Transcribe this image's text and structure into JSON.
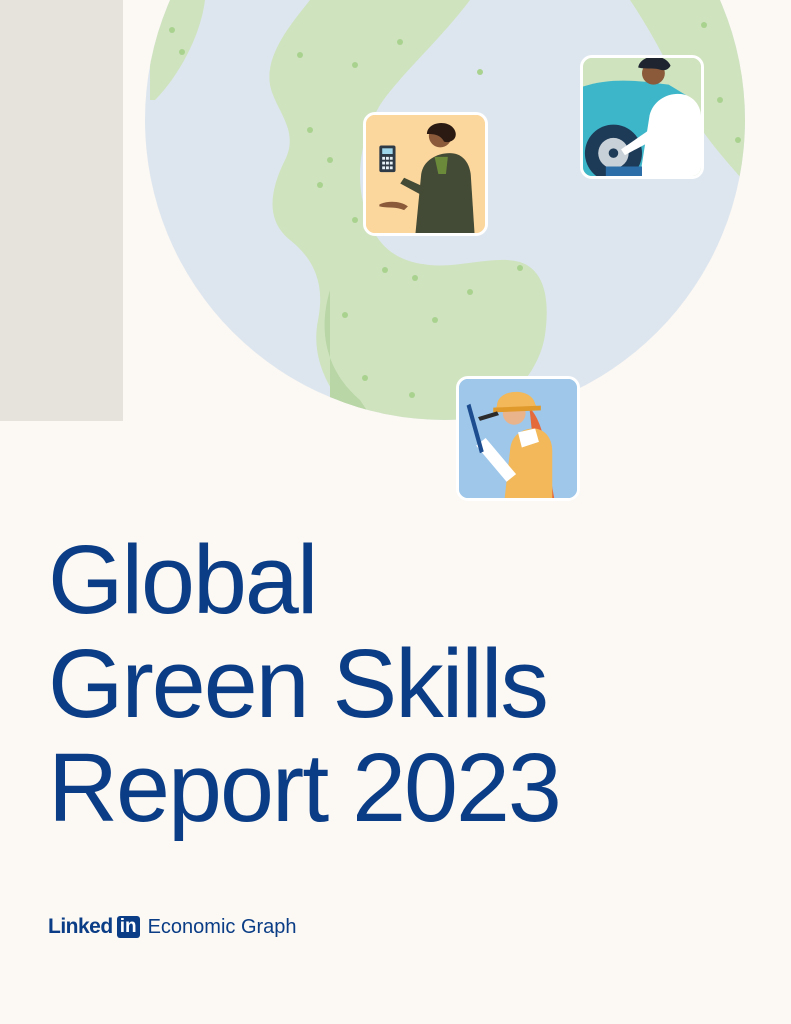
{
  "title_lines": [
    "Global",
    "Green Skills",
    "Report 2023"
  ],
  "brand": {
    "word": "Linked",
    "in_badge": "in",
    "subtitle": "Economic Graph"
  },
  "colors": {
    "background": "#fcf8f3",
    "band": "#e6e3dd",
    "globe_ocean": "#dde6ef",
    "globe_land": "#cfe3bf",
    "title": "#0a3d86"
  },
  "illustration": {
    "tiles": [
      {
        "label": "person-with-calculator"
      },
      {
        "label": "mechanic-with-car"
      },
      {
        "label": "engineer-with-hardhat"
      }
    ]
  }
}
